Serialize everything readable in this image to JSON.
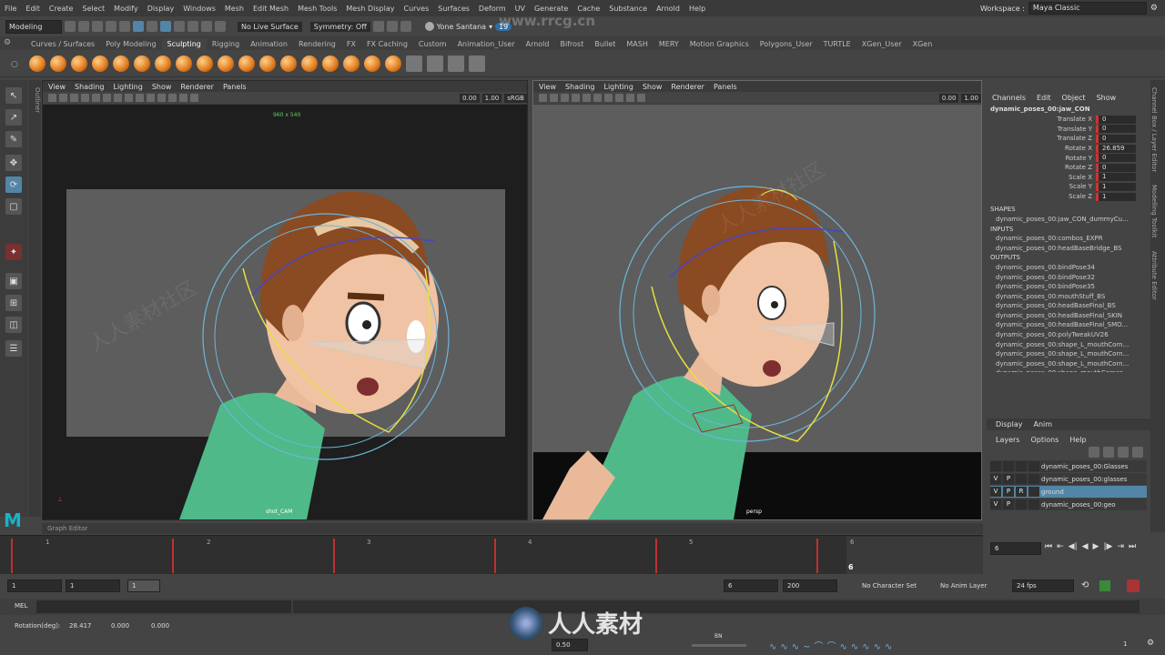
{
  "menu": [
    "File",
    "Edit",
    "Create",
    "Select",
    "Modify",
    "Display",
    "Windows",
    "Mesh",
    "Edit Mesh",
    "Mesh Tools",
    "Mesh Display",
    "Curves",
    "Surfaces",
    "Deform",
    "UV",
    "Generate",
    "Cache",
    "Substance",
    "Arnold",
    "Help"
  ],
  "workspace": {
    "label": "Workspace :",
    "value": "Maya Classic"
  },
  "status": {
    "mode": "Modeling",
    "live": "No Live Surface",
    "symmetry": "Symmetry: Off",
    "user": "Yone Santana",
    "notif": "19"
  },
  "shelf_tabs": [
    "Curves / Surfaces",
    "Poly Modeling",
    "Sculpting",
    "Rigging",
    "Animation",
    "Rendering",
    "FX",
    "FX Caching",
    "Custom",
    "Animation_User",
    "Arnold",
    "Bifrost",
    "Bullet",
    "MASH",
    "MERY",
    "Motion Graphics",
    "Polygons_User",
    "TURTLE",
    "XGen_User",
    "XGen"
  ],
  "active_shelf": "Sculpting",
  "outliner_label": "Outliner",
  "vp_left": {
    "menus": [
      "View",
      "Shading",
      "Lighting",
      "Show",
      "Renderer",
      "Panels"
    ],
    "n1": "0.00",
    "n2": "1.00",
    "cs": "sRGB",
    "res": "960 x 540",
    "cam": "shot_CAM"
  },
  "vp_right": {
    "menus": [
      "View",
      "Shading",
      "Lighting",
      "Show",
      "Renderer",
      "Panels"
    ],
    "n1": "0.00",
    "n2": "1.00",
    "cam": "persp"
  },
  "channel": {
    "menus": [
      "Channels",
      "Edit",
      "Object",
      "Show"
    ],
    "obj": "dynamic_poses_00:jaw_CON",
    "attrs": [
      [
        "Translate X",
        "0"
      ],
      [
        "Translate Y",
        "0"
      ],
      [
        "Translate Z",
        "0"
      ],
      [
        "Rotate X",
        "26.859"
      ],
      [
        "Rotate Y",
        "0"
      ],
      [
        "Rotate Z",
        "0"
      ],
      [
        "Scale X",
        "1"
      ],
      [
        "Scale Y",
        "1"
      ],
      [
        "Scale Z",
        "1"
      ]
    ],
    "shapes_h": "SHAPES",
    "shape": "dynamic_poses_00:jaw_CON_dummyCu...",
    "inputs_h": "INPUTS",
    "inputs": [
      "dynamic_poses_00:combos_EXPR",
      "dynamic_poses_00:headBaseBridge_BS"
    ],
    "outputs_h": "OUTPUTS",
    "outputs": [
      "dynamic_poses_00:bindPose34",
      "dynamic_poses_00:bindPose32",
      "dynamic_poses_00:bindPose35",
      "dynamic_poses_00:mouthStuff_BS",
      "dynamic_poses_00:headBaseFinal_BS",
      "dynamic_poses_00:headBaseFinal_SKIN",
      "dynamic_poses_00:headBaseFinal_SMO...",
      "dynamic_poses_00:polyTweakUV26",
      "dynamic_poses_00:shape_L_mouthCorn...",
      "dynamic_poses_00:shape_L_mouthCorn...",
      "dynamic_poses_00:shape_L_mouthCorn...",
      "dynamic_poses_00:shape_mouthCorner...",
      "dynamic_poses_00:shape_mouthCorner...",
      "dynamic_poses_00:shape_L_mouthCorn...",
      "dynamic_poses_00:shape_L_mouthCorn...",
      "dynamic_poses_00:shape_L_mouthCorn..."
    ]
  },
  "layers": {
    "tabs": [
      "Display",
      "Anim"
    ],
    "menus": [
      "Layers",
      "Options",
      "Help"
    ],
    "rows": [
      {
        "v": "",
        "p": "",
        "r": "",
        "name": "dynamic_poses_00:Glasses"
      },
      {
        "v": "V",
        "p": "P",
        "r": "",
        "name": "dynamic_poses_00:glasses"
      },
      {
        "v": "V",
        "p": "P",
        "r": "R",
        "name": "ground"
      },
      {
        "v": "V",
        "p": "P",
        "r": "",
        "name": "dynamic_poses_00:geo"
      }
    ]
  },
  "side_tabs": [
    "Channel Box / Layer Editor",
    "Modelling Toolkit",
    "Attribute Editor"
  ],
  "graph_editor": "Graph Editor",
  "timeline": {
    "ticks": [
      "1",
      "2",
      "3",
      "4",
      "5",
      "6"
    ],
    "current": "6",
    "frame_field": "6"
  },
  "range": {
    "start": "1",
    "start2": "1",
    "layer": "1",
    "end": "6",
    "end2": "200",
    "char": "No Character Set",
    "anim": "No Anim Layer",
    "fps": "24 fps"
  },
  "mel": "MEL",
  "help": {
    "label": "Rotation(deg):",
    "vals": [
      "28.417",
      "0.000",
      "0.000"
    ],
    "step": "0.50",
    "bn": "BN",
    "frame": "1"
  },
  "watermark": {
    "site": "www.rrcg.cn",
    "brand": "人人素材",
    "wm": "人人素材社区"
  }
}
